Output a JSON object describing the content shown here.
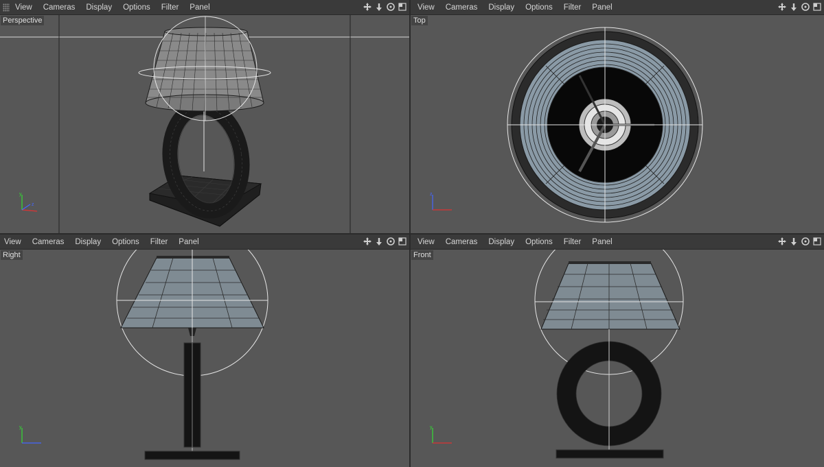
{
  "menu": [
    "View",
    "Cameras",
    "Display",
    "Options",
    "Filter",
    "Panel"
  ],
  "viewports": [
    {
      "id": "perspective",
      "label": "Perspective"
    },
    {
      "id": "top",
      "label": "Top"
    },
    {
      "id": "right",
      "label": "Right"
    },
    {
      "id": "front",
      "label": "Front"
    }
  ],
  "icons": {
    "move": "move-view-icon",
    "dolly": "dolly-view-icon",
    "rotate": "rotate-view-icon",
    "maximize": "maximize-view-icon"
  },
  "colors": {
    "viewport_bg": "#575757",
    "toolbar_bg": "#3a3a3a",
    "axis_x": "#d33",
    "axis_y": "#3d3",
    "axis_z": "#46f"
  }
}
